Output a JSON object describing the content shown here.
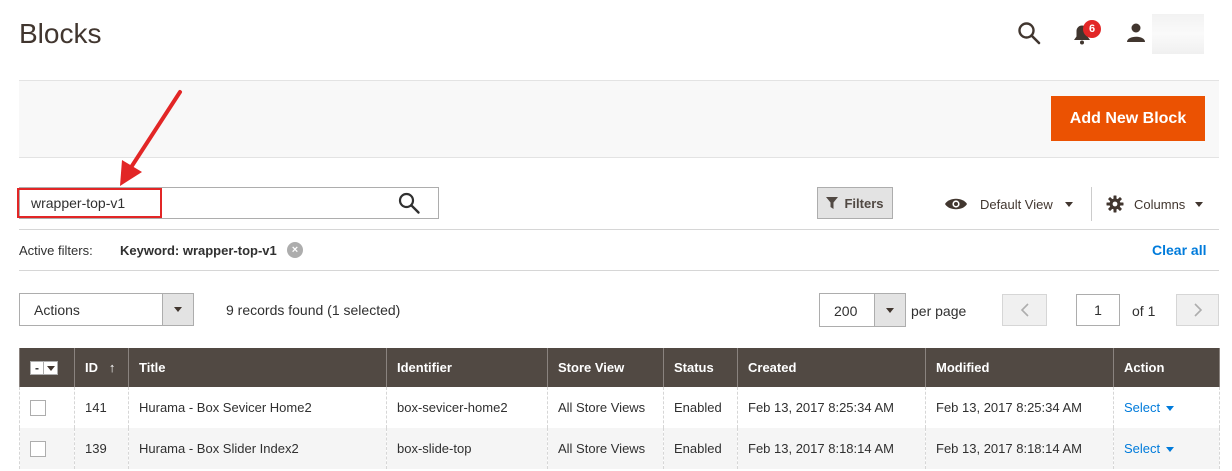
{
  "header": {
    "title": "Blocks",
    "notification_count": "6"
  },
  "action_bar": {
    "add_button_label": "Add New Block"
  },
  "search": {
    "value": "wrapper-top-v1"
  },
  "toolbar": {
    "filters_label": "Filters",
    "view_label": "Default View",
    "columns_label": "Columns"
  },
  "active_filters": {
    "label": "Active filters:",
    "keyword": "Keyword: wrapper-top-v1",
    "clear_all": "Clear all"
  },
  "listing": {
    "actions_label": "Actions",
    "records_found": "9 records found (1 selected)",
    "per_page_value": "200",
    "per_page_label": "per page",
    "current_page": "1",
    "page_of": "of 1"
  },
  "grid": {
    "columns": {
      "id": "ID",
      "id_sort": "↑",
      "title": "Title",
      "identifier": "Identifier",
      "store_view": "Store View",
      "status": "Status",
      "created": "Created",
      "modified": "Modified",
      "action": "Action"
    },
    "mass_select_symbol": "-",
    "rows": [
      {
        "id": "141",
        "title": "Hurama - Box Sevicer Home2",
        "identifier": "box-sevicer-home2",
        "store_view": "All Store Views",
        "status": "Enabled",
        "created": "Feb 13, 2017 8:25:34 AM",
        "modified": "Feb 13, 2017 8:25:34 AM",
        "action": "Select"
      },
      {
        "id": "139",
        "title": "Hurama - Box Slider Index2",
        "identifier": "box-slide-top",
        "store_view": "All Store Views",
        "status": "Enabled",
        "created": "Feb 13, 2017 8:18:14 AM",
        "modified": "Feb 13, 2017 8:18:14 AM",
        "action": "Select"
      }
    ]
  },
  "colors": {
    "accent": "#eb5202",
    "grid_header": "#514943",
    "link": "#007bdb",
    "annotation": "#e22626"
  }
}
